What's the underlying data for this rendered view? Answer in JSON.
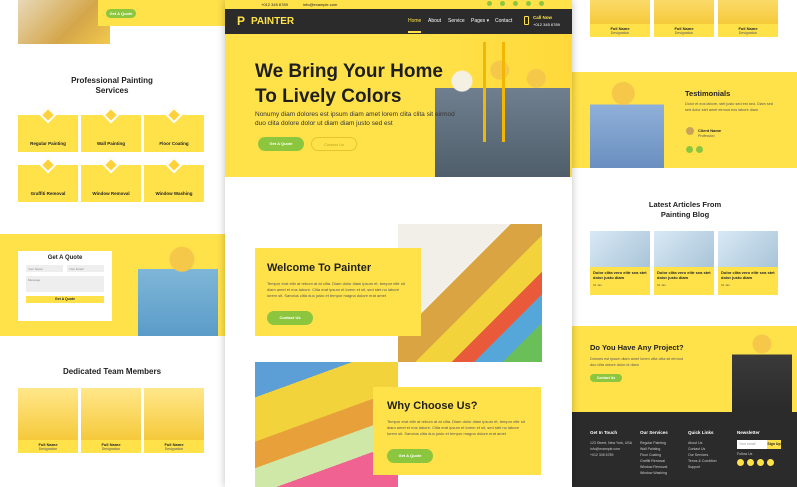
{
  "left": {
    "services_title": "Professional Painting Services",
    "services": [
      "Regular Painting",
      "Wall Painting",
      "Floor Coating",
      "Graffiti Removal",
      "Window Removal",
      "Window Washing"
    ],
    "quote_title": "Get A Quote",
    "quote_fields": [
      "Your Name",
      "Your Email",
      "Message"
    ],
    "quote_button": "Get A Quote",
    "team_title": "Dedicated Team Members",
    "team": [
      {
        "name": "Full Name",
        "role": "Designation"
      },
      {
        "name": "Full Name",
        "role": "Designation"
      },
      {
        "name": "Full Name",
        "role": "Designation"
      }
    ],
    "top_button": "Get A Quote"
  },
  "center": {
    "topbar_phone": "+012 345 6789",
    "topbar_email": "info@example.com",
    "logo": "PAINTER",
    "nav": [
      "Home",
      "About",
      "Service",
      "Pages ▾",
      "Contact"
    ],
    "call_label": "Call Now",
    "call_number": "+012 345 6789",
    "hero_title_1": "We Bring Your Home",
    "hero_title_2": "To Lively Colors",
    "hero_text": "Nonumy diam dolores est ipsum diam amet lorem clita clita sit eirmod duo clita dolore dolor ut diam diam justo sed est",
    "hero_btn_1": "Get A Quote",
    "hero_btn_2": "Contact Us",
    "welcome_title": "Welcome To Painter",
    "welcome_text": "Tempor erat elitr at rebum at at clita. Diam dolor diam ipsum et, tempor elitr sit diam amet et eos labore. Clita erat ipsum et lorem et sit, sed stet no labore lorem sit. Sanctus clita duo justo et tempor magna dolore erat amet",
    "welcome_btn": "Contact Us",
    "why_title": "Why Choose Us?",
    "why_text": "Tempor erat elitr at rebum at at clita. Diam dolor diam ipsum et, tempor elitr sit diam amet et eos labore. Clita erat ipsum et lorem et sit, sed stet no labore lorem sit. Sanctus clita duo justo et tempor magna dolore erat amet",
    "why_btn": "Get A Quote"
  },
  "right": {
    "team": [
      {
        "name": "Full Name",
        "role": "Designation"
      },
      {
        "name": "Full Name",
        "role": "Designation"
      },
      {
        "name": "Full Name",
        "role": "Designation"
      }
    ],
    "testimonials_title": "Testimonials",
    "testimonial_text": "Dolor et eos labore, stet justo sed est sed. Diam sed sed dolor stet amet eirmod eos labore diam",
    "client_name": "Client Name",
    "client_role": "Profession",
    "blog_title": "Latest Articles From Painting Blog",
    "blog_posts": [
      {
        "title": "Dolor clita vero elitr sea stet dolor justo diam",
        "date": "01 Jan"
      },
      {
        "title": "Dolor clita vero elitr sea stet dolor justo diam",
        "date": "01 Jan"
      },
      {
        "title": "Dolor clita vero elitr sea stet dolor justo diam",
        "date": "01 Jan"
      }
    ],
    "project_title": "Do You Have Any Project?",
    "project_text": "Dolores est ipsum diam amet lorem clita clita sit eirmod duo clita dolore dolor ut diam",
    "project_btn": "Contact Us",
    "footer": {
      "touch_title": "Get In Touch",
      "touch_items": [
        "123 Street, New York, USA",
        "info@example.com",
        "+012 345 6789"
      ],
      "services_title": "Our Services",
      "services_items": [
        "Regular Painting",
        "Wall Painting",
        "Floor Coating",
        "Graffiti Removal",
        "Window Removal",
        "Window Washing"
      ],
      "links_title": "Quick Links",
      "links_items": [
        "About Us",
        "Contact Us",
        "Our Services",
        "Terms & Condition",
        "Support"
      ],
      "newsletter_title": "Newsletter",
      "newsletter_placeholder": "Your email",
      "newsletter_btn": "Sign Up",
      "follow_label": "Follow Us"
    }
  },
  "colors": {
    "yellow": "#FFE24A",
    "green": "#8CC63F",
    "dark": "#2B2B2B"
  }
}
